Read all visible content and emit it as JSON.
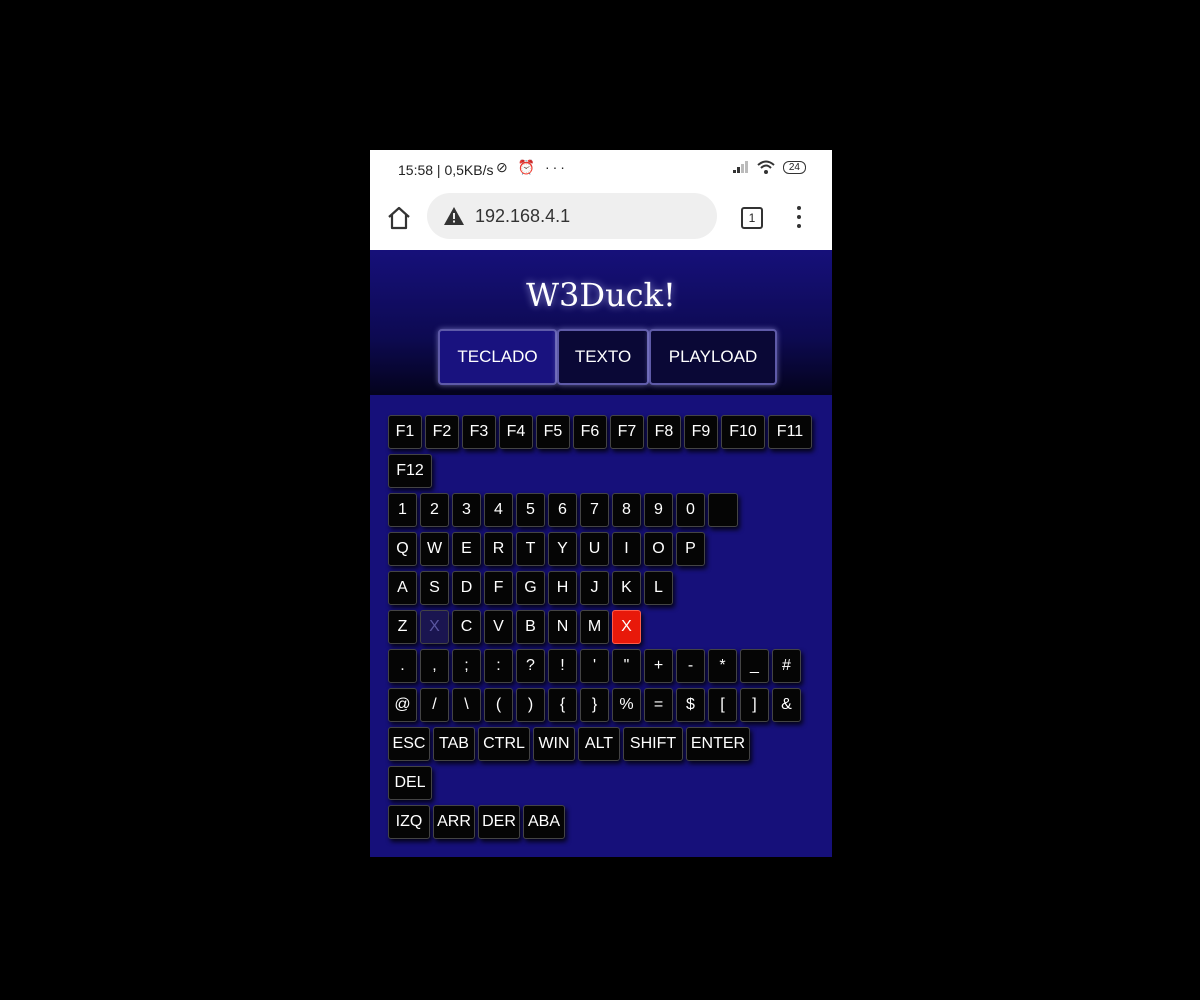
{
  "status_bar": {
    "time": "15:58 | 0,5KB/s",
    "left_icons": [
      "do-not-disturb-icon",
      "alarm-icon",
      "more-icon"
    ],
    "right_icons": [
      "signal-icon",
      "wifi-icon"
    ],
    "battery": "24"
  },
  "browser": {
    "url": "192.168.4.1",
    "tab_count": "1"
  },
  "app": {
    "title": "W3Duck!",
    "tabs": [
      {
        "label": "TECLADO",
        "active": true
      },
      {
        "label": "TEXTO",
        "active": false
      },
      {
        "label": "PLAYLOAD",
        "active": false
      }
    ]
  },
  "keyboard": {
    "rows": [
      [
        "F1",
        "F2",
        "F3",
        "F4",
        "F5",
        "F6",
        "F7",
        "F8",
        "F9",
        "F10",
        "F11"
      ],
      [
        "F12"
      ],
      [
        "1",
        "2",
        "3",
        "4",
        "5",
        "6",
        "7",
        "8",
        "9",
        "0",
        ""
      ],
      [
        "Q",
        "W",
        "E",
        "R",
        "T",
        "Y",
        "U",
        "I",
        "O",
        "P"
      ],
      [
        "A",
        "S",
        "D",
        "F",
        "G",
        "H",
        "J",
        "K",
        "L"
      ],
      [
        "Z",
        "X",
        "C",
        "V",
        "B",
        "N",
        "M",
        "X"
      ],
      [
        ".",
        ",",
        ";",
        ":",
        "?",
        "!",
        "'",
        "\"",
        "+",
        "-",
        "*",
        "_",
        "#"
      ],
      [
        "@",
        "/",
        "\\",
        "(",
        ")",
        "{",
        "}",
        "%",
        "=",
        "$",
        "[",
        "]",
        "&"
      ],
      [
        "ESC",
        "TAB",
        "CTRL",
        "WIN",
        "ALT",
        "SHIFT",
        "ENTER"
      ],
      [
        "DEL"
      ],
      [
        "IZQ",
        "ARR",
        "DER",
        "ABA"
      ]
    ],
    "pressed_key": "X",
    "pressed_color": "#e8190a",
    "background_color": "#16107a"
  }
}
